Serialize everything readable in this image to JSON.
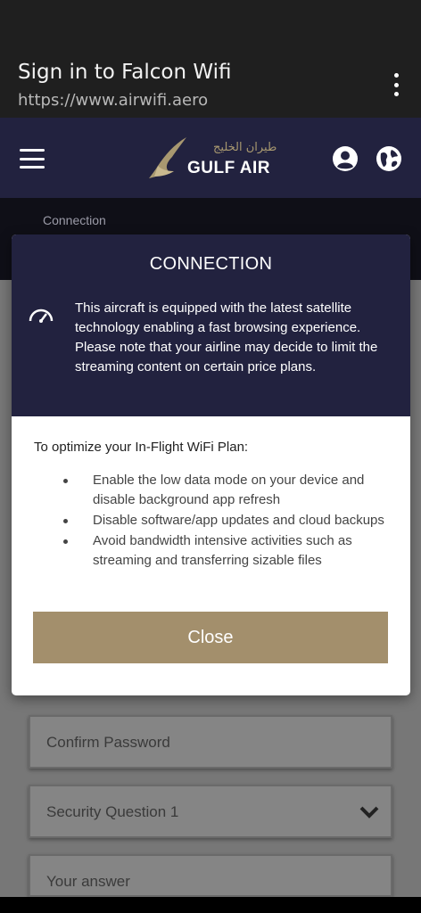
{
  "browser": {
    "title": "Sign in to Falcon Wifi",
    "url": "https://www.airwifi.aero"
  },
  "header": {
    "logo_text": "GULF AIR",
    "logo_arabic": "طيران الخليج",
    "icons": [
      "menu-icon",
      "user-icon",
      "globe-icon"
    ]
  },
  "background": {
    "section_label": "Connection",
    "fields": [
      {
        "placeholder": "Confirm Password"
      },
      {
        "value": "Security Question 1"
      },
      {
        "placeholder": "Your answer"
      }
    ]
  },
  "modal": {
    "title": "CONNECTION",
    "description": "This aircraft is equipped with the latest satellite technology enabling a fast browsing experience. Please note that your airline may decide to limit the streaming content on certain price plans.",
    "tips_title": "To optimize your In-Flight WiFi Plan:",
    "tips": [
      "Enable the low data mode on your device and disable background app refresh",
      "Disable software/app updates and cloud backups",
      "Avoid bandwidth intensive activities such as streaming and transferring sizable files"
    ],
    "close_label": "Close"
  },
  "colors": {
    "navy": "#22223f",
    "gold": "#a38f6c"
  }
}
